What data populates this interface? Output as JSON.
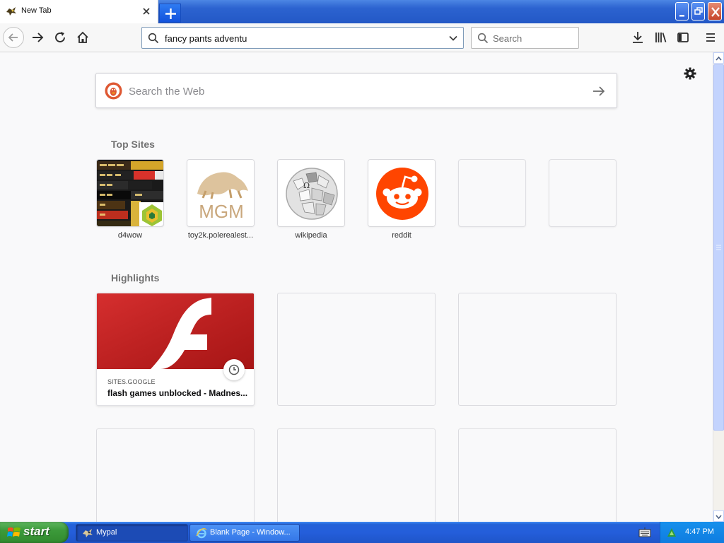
{
  "browser": {
    "tab": {
      "title": "New Tab"
    },
    "url_bar": {
      "value": "fancy pants adventu"
    },
    "search_bar": {
      "placeholder": "Search"
    }
  },
  "newtab": {
    "web_search": {
      "placeholder": "Search the Web"
    },
    "top_sites": {
      "heading": "Top Sites",
      "sites": [
        {
          "label": "d4wow",
          "thumb": "d4wow-screenshot"
        },
        {
          "label": "toy2k.polerealest...",
          "thumb": "mgm-logo",
          "logo_text": "MGM"
        },
        {
          "label": "wikipedia",
          "thumb": "wikipedia-globe",
          "logo_text": "Ω"
        },
        {
          "label": "reddit",
          "thumb": "reddit-alien"
        },
        {
          "label": "",
          "thumb": "empty"
        },
        {
          "label": "",
          "thumb": "empty"
        }
      ]
    },
    "highlights": {
      "heading": "Highlights",
      "cards": [
        {
          "source": "SITES.GOOGLE",
          "title": "flash games unblocked - Madnes...",
          "thumb": "flash-player-logo",
          "badge_icon": "clock-icon"
        }
      ]
    }
  },
  "taskbar": {
    "start_label": "start",
    "buttons": [
      {
        "label": "Mypal",
        "icon": "mypal-icon",
        "active": true
      },
      {
        "label": "Blank Page - Window...",
        "icon": "ie-icon",
        "active": false
      }
    ],
    "clock": "4:47 PM"
  },
  "colors": {
    "reddit": "#ff4500",
    "flash_red": "#c41e1e",
    "xp_blue": "#245edb",
    "xp_green": "#3c9a3a"
  }
}
